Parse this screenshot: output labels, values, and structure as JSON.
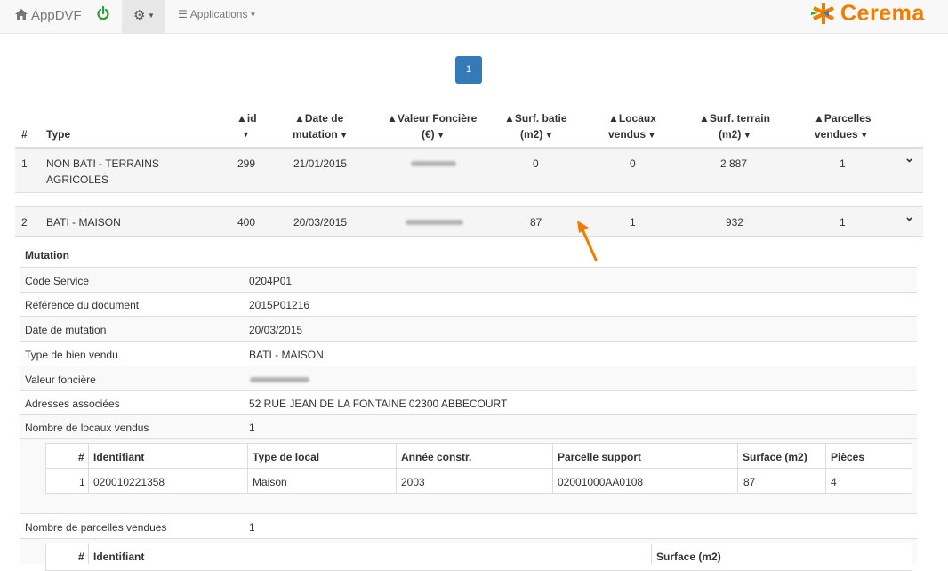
{
  "navbar": {
    "brand": "AppDVF",
    "apps_label": "Applications",
    "logo_text": "Cerema",
    "icons": [
      "home-icon",
      "power-icon",
      "gear-icon",
      "list-icon"
    ],
    "accent": "#337ab7",
    "logo_color": "#f07d00"
  },
  "pagination": {
    "current": "1"
  },
  "table": {
    "headers": {
      "num": "#",
      "type": "Type",
      "id": "id",
      "date_1": "Date de",
      "date_2": "mutation",
      "valeur_1": "Valeur Foncière",
      "valeur_2": "(€)",
      "surf_bati_1": "Surf. batie",
      "surf_bati_2": "(m2)",
      "locaux_1": "Locaux",
      "locaux_2": "vendus",
      "surf_terrain_1": "Surf. terrain",
      "surf_terrain_2": "(m2)",
      "parcelles_1": "Parcelles",
      "parcelles_2": "vendues"
    },
    "rows": [
      {
        "num": "1",
        "type_1": "NON BATI - TERRAINS",
        "type_2": "AGRICOLES",
        "id": "299",
        "date": "21/01/2015",
        "surf_bati": "0",
        "locaux": "0",
        "surf_terrain": "2 887",
        "parcelles": "1"
      },
      {
        "num": "2",
        "type_1": "BATI - MAISON",
        "type_2": "",
        "id": "400",
        "date": "20/03/2015",
        "surf_bati": "87",
        "locaux": "1",
        "surf_terrain": "932",
        "parcelles": "1"
      }
    ]
  },
  "detail": {
    "section_title": "Mutation",
    "fields": [
      {
        "label": "Code Service",
        "value": "0204P01"
      },
      {
        "label": "Référence du document",
        "value": "2015P01216"
      },
      {
        "label": "Date de mutation",
        "value": "20/03/2015"
      },
      {
        "label": "Type de bien vendu",
        "value": "BATI - MAISON"
      },
      {
        "label": "Valeur foncière",
        "value": ""
      },
      {
        "label": "Adresses associées",
        "value": "52 RUE JEAN DE LA FONTAINE 02300 ABBECOURT"
      },
      {
        "label": "Nombre de locaux vendus",
        "value": "1"
      }
    ],
    "locaux_table": {
      "headers": [
        "#",
        "Identifiant",
        "Type de local",
        "Année constr.",
        "Parcelle support",
        "Surface (m2)",
        "Pièces"
      ],
      "rows": [
        [
          "1",
          "020010221358",
          "Maison",
          "2003",
          "02001000AA0108",
          "87",
          "4"
        ]
      ]
    },
    "parcelles_label": "Nombre de parcelles vendues",
    "parcelles_value": "1",
    "parcelles_table": {
      "headers": [
        "#",
        "Identifiant",
        "Surface (m2)"
      ]
    }
  }
}
